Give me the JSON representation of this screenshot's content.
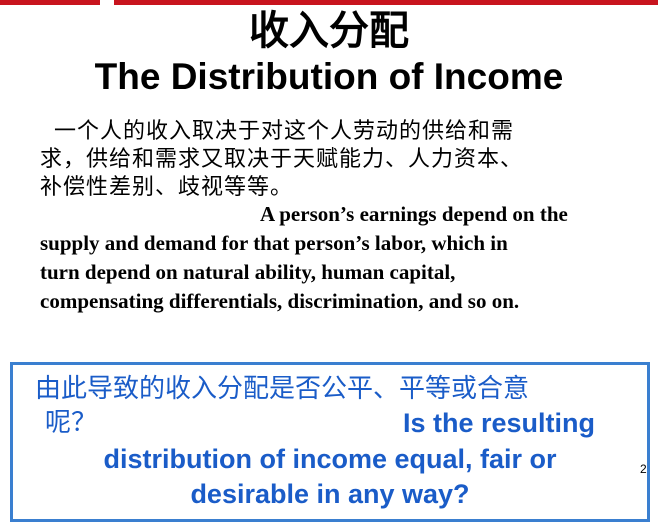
{
  "slide": {
    "title_zh": "收入分配",
    "title_en": "The Distribution of Income",
    "body_zh": [
      "一个人的收入取决于对这个人劳动的供给和需",
      "求，供给和需求又取决于天赋能力、人力资本、",
      "补偿性差别、歧视等等。"
    ],
    "body_en": [
      "A person’s earnings depend on the",
      "supply and demand for that person’s labor, which in",
      "turn depend on natural ability, human capital,",
      "compensating differentials, discrimination, and so on."
    ],
    "question": {
      "zh_line1": "由此导致的收入分配是否公平、平等或合意",
      "zh_line2": "呢？",
      "en_line1": "Is the resulting",
      "en_line2": "distribution of income equal, fair or",
      "en_line3": "desirable in any way?"
    },
    "page_number": "2"
  },
  "colors": {
    "accent_red": "#c8141e",
    "question_blue": "#1a5cc8",
    "box_border": "#3a7fd0"
  }
}
